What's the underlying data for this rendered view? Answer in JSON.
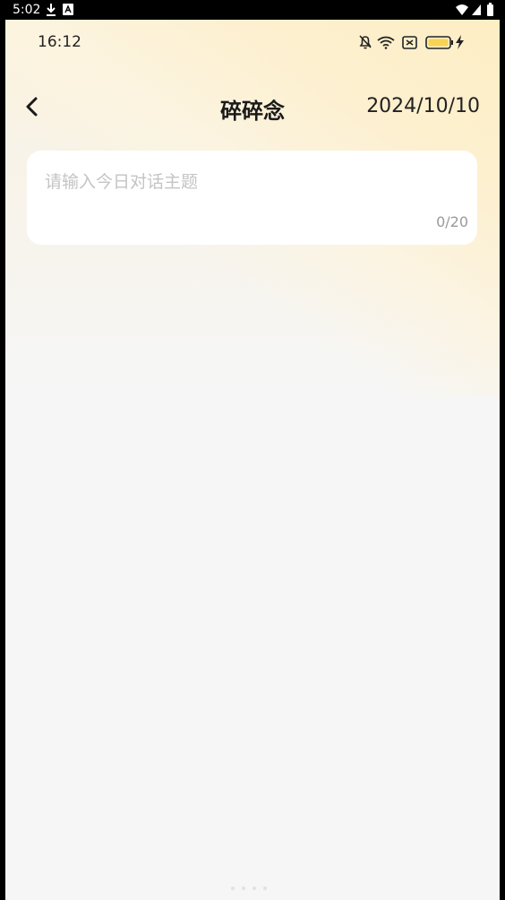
{
  "system_status": {
    "time": "5:02",
    "icons": [
      "download-icon",
      "a-icon",
      "wifi-icon",
      "signal-icon",
      "battery-icon"
    ]
  },
  "app_status": {
    "time": "16:12",
    "icons": [
      "mute-bell-icon",
      "wifi-icon",
      "sim-icon",
      "battery-charging-icon"
    ]
  },
  "header": {
    "title": "碎碎念",
    "date": "2024/10/10",
    "back_icon": "chevron-left-icon"
  },
  "topic_input": {
    "placeholder": "请输入今日对话主题",
    "value": "",
    "counter": "0/20"
  },
  "colors": {
    "accent_gradient": "#fdeec4",
    "background": "#f6f6f6",
    "card": "#ffffff",
    "placeholder": "#c4c4c4"
  }
}
